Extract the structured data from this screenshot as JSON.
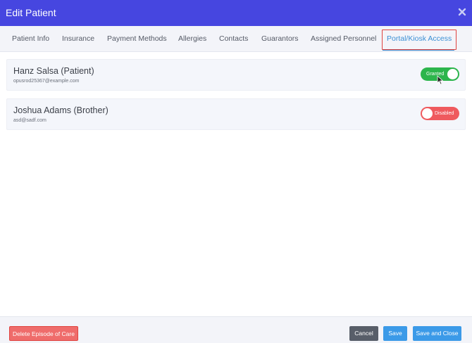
{
  "header": {
    "title": "Edit Patient"
  },
  "tabs": [
    {
      "label": "Patient Info",
      "active": false
    },
    {
      "label": "Insurance",
      "active": false
    },
    {
      "label": "Payment Methods",
      "active": false
    },
    {
      "label": "Allergies",
      "active": false
    },
    {
      "label": "Contacts",
      "active": false
    },
    {
      "label": "Guarantors",
      "active": false
    },
    {
      "label": "Assigned Personnel",
      "active": false
    },
    {
      "label": "Portal/Kiosk Access",
      "active": true
    }
  ],
  "people": [
    {
      "name": "Hanz Salsa (Patient)",
      "email": "opusrod25367@example.com",
      "access_label": "Granted",
      "access_on": true
    },
    {
      "name": "Joshua Adams (Brother)",
      "email": "asd@sadf.com",
      "access_label": "Disabled",
      "access_on": false
    }
  ],
  "footer": {
    "delete_label": "Delete Episode of Care",
    "cancel_label": "Cancel",
    "save_label": "Save",
    "save_close_label": "Save and Close"
  },
  "colors": {
    "header_bg": "#4646e0",
    "active_tab": "#3b8fd4",
    "highlight_box": "#e0433f",
    "toggle_on": "#2cb54c",
    "toggle_off": "#ef5a5e",
    "delete_button": "#ef6c6b",
    "cancel_button": "#585e69",
    "save_button": "#3b9ae8"
  },
  "icons": {
    "close": "close-icon",
    "cursor": "mouse-pointer-icon"
  }
}
